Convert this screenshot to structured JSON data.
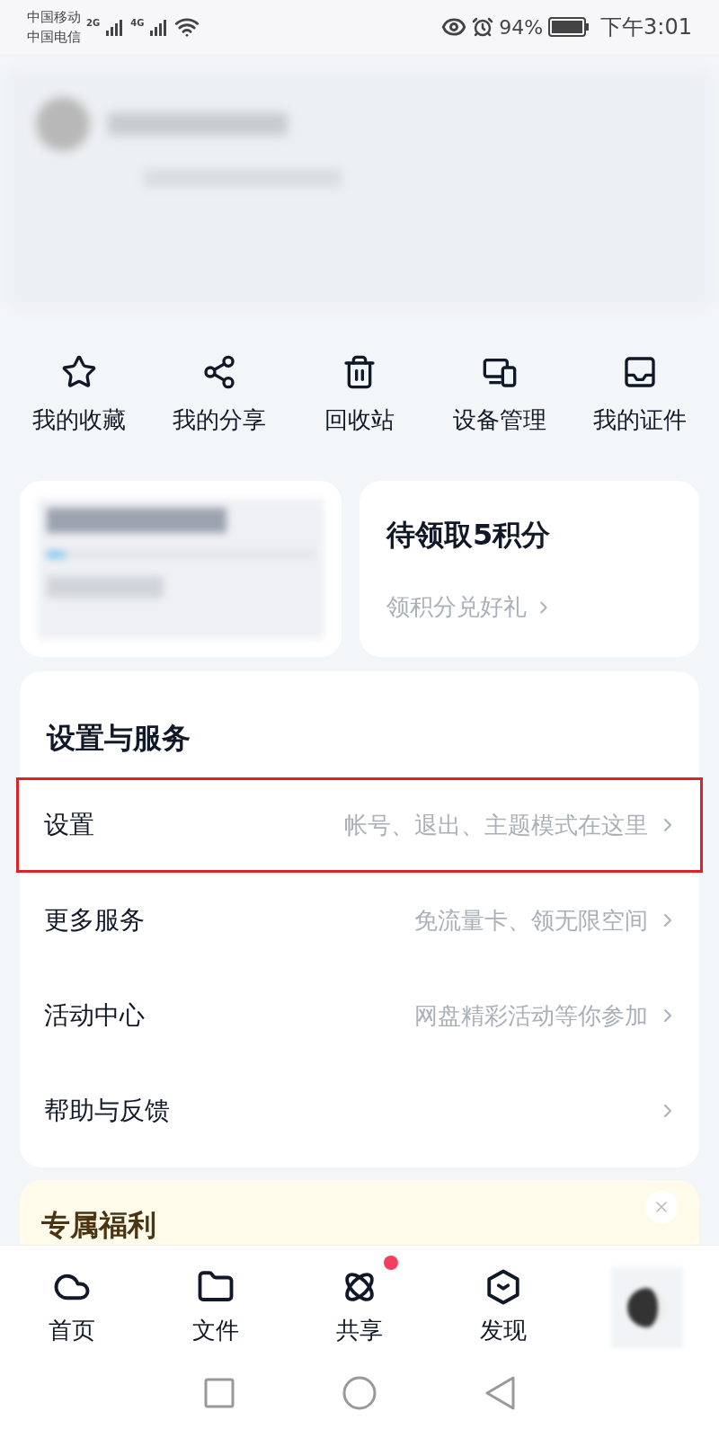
{
  "status_bar": {
    "carrier_1": "中国移动",
    "carrier_2": "中国电信",
    "network_1": "2G",
    "network_2": "4G",
    "battery": "94%",
    "time": "下午3:01"
  },
  "shortcuts": [
    {
      "kind": "star",
      "label": "我的收藏"
    },
    {
      "kind": "share",
      "label": "我的分享"
    },
    {
      "kind": "trash",
      "label": "回收站"
    },
    {
      "kind": "devices",
      "label": "设备管理"
    },
    {
      "kind": "card",
      "label": "我的证件"
    }
  ],
  "points_card": {
    "title": "待领取5积分",
    "link": "领积分兑好礼"
  },
  "services": {
    "title": "设置与服务",
    "items": [
      {
        "label": "设置",
        "hint": "帐号、退出、主题模式在这里",
        "highlighted": true
      },
      {
        "label": "更多服务",
        "hint": "免流量卡、领无限空间",
        "highlighted": false
      },
      {
        "label": "活动中心",
        "hint": "网盘精彩活动等你参加",
        "highlighted": false
      },
      {
        "label": "帮助与反馈",
        "highlighted": false
      }
    ]
  },
  "promo": {
    "title": "专属福利"
  },
  "tab_bar": [
    {
      "kind": "cloud",
      "label": "首页",
      "badge": false
    },
    {
      "kind": "folder",
      "label": "文件",
      "badge": false
    },
    {
      "kind": "atom",
      "label": "共享",
      "badge": true
    },
    {
      "kind": "cube",
      "label": "发现",
      "badge": false
    },
    {
      "kind": "avatar",
      "badge": false
    }
  ]
}
